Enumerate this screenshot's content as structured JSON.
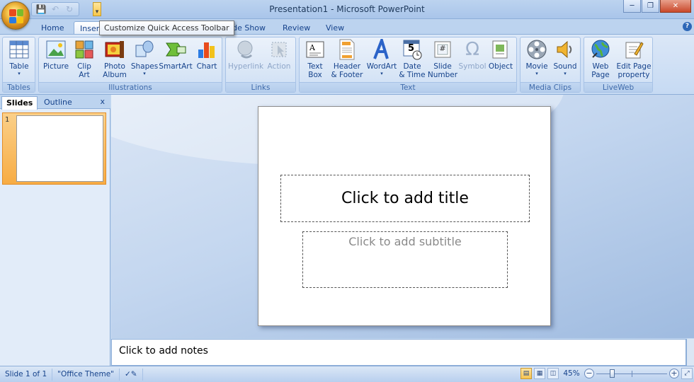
{
  "window": {
    "title": "Presentation1 - Microsoft PowerPoint"
  },
  "qat": {
    "tooltip": "Customize Quick Access Toolbar"
  },
  "tabs": [
    {
      "label": "Home"
    },
    {
      "label": "Inser"
    },
    {
      "label": "Slide Show"
    },
    {
      "label": "Review"
    },
    {
      "label": "View"
    }
  ],
  "ribbon": {
    "groups": {
      "tables": "Tables",
      "illustrations": "Illustrations",
      "links": "Links",
      "text": "Text",
      "media": "Media Clips",
      "liveweb": "LiveWeb"
    },
    "buttons": {
      "table": [
        "Table",
        ""
      ],
      "picture": [
        "Picture",
        ""
      ],
      "clipart": [
        "Clip",
        "Art"
      ],
      "photoalbum": [
        "Photo",
        "Album"
      ],
      "shapes": [
        "Shapes",
        ""
      ],
      "smartart": [
        "SmartArt",
        ""
      ],
      "chart": [
        "Chart",
        ""
      ],
      "hyperlink": [
        "Hyperlink",
        ""
      ],
      "action": [
        "Action",
        ""
      ],
      "textbox": [
        "Text",
        "Box"
      ],
      "headerfooter": [
        "Header",
        "& Footer"
      ],
      "wordart": [
        "WordArt",
        ""
      ],
      "datetime": [
        "Date",
        "& Time"
      ],
      "slidenumber": [
        "Slide",
        "Number"
      ],
      "symbol": [
        "Symbol",
        ""
      ],
      "object": [
        "Object",
        ""
      ],
      "movie": [
        "Movie",
        ""
      ],
      "sound": [
        "Sound",
        ""
      ],
      "webpage": [
        "Web",
        "Page"
      ],
      "editpage": [
        "Edit Page",
        "property"
      ]
    },
    "datetime_icon_digit": "5",
    "slidenumber_icon_glyph": "#"
  },
  "pane": {
    "tabs": [
      "Slides",
      "Outline"
    ],
    "close": "x",
    "slide_number": "1"
  },
  "slide": {
    "title_placeholder": "Click to add title",
    "subtitle_placeholder": "Click to add subtitle"
  },
  "notes": {
    "placeholder": "Click to add notes"
  },
  "status": {
    "slide_info": "Slide 1 of 1",
    "theme": "\"Office Theme\"",
    "zoom": "45%"
  },
  "colors": {
    "accent": "#15428b",
    "ribbon": "#c6daf3",
    "selected": "#f7ac44"
  },
  "zoom_fraction": 0.45
}
